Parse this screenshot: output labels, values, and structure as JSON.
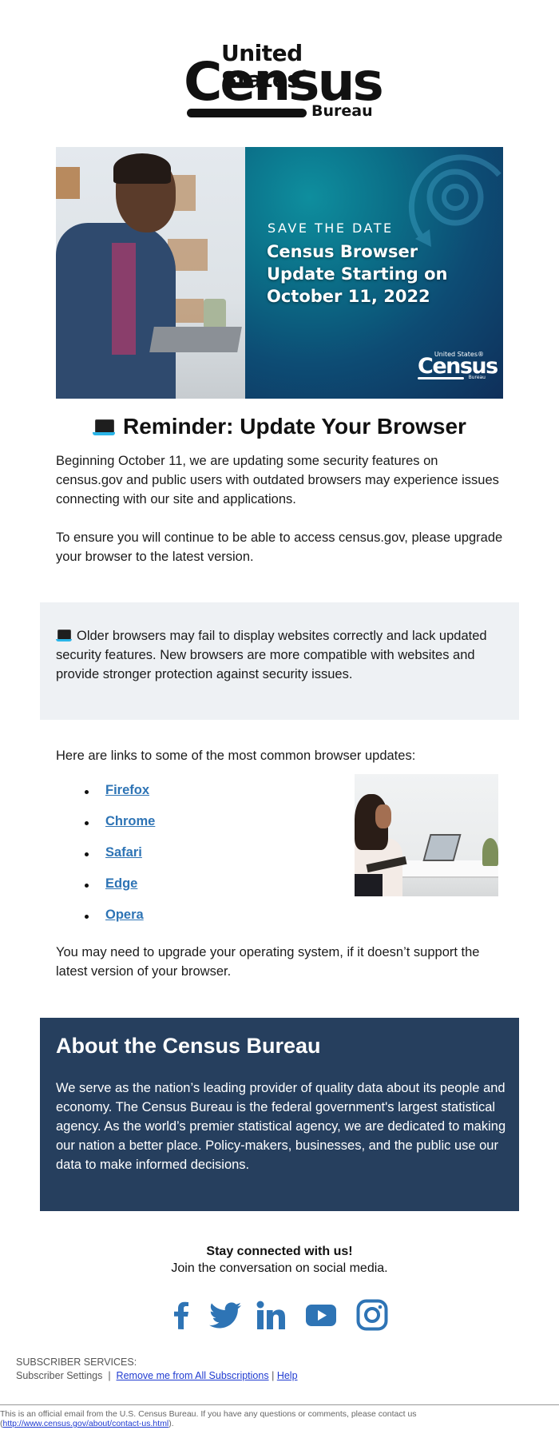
{
  "logo": {
    "line1": "United States",
    "registered": "®",
    "line2": "Census",
    "line3": "Bureau"
  },
  "hero": {
    "eyebrow": "SAVE THE DATE",
    "title": "Census Browser Update Starting on October 11, 2022",
    "mini_logo": {
      "line1": "United States®",
      "line2": "Census",
      "line3": "Bureau"
    }
  },
  "reminder": {
    "icon": "laptop-icon",
    "heading": "Reminder: Update Your Browser",
    "paragraph1": "Beginning October 11, we are updating some security features on census.gov and public users with outdated browsers may experience issues connecting with our site and applications.",
    "paragraph2": "To ensure you will continue to be able to access census.gov, please upgrade your browser to the latest version."
  },
  "notice": {
    "icon": "laptop-icon",
    "text": "Older browsers may fail to display websites correctly and lack updated security features. New browsers are more compatible with websites and provide stronger protection against security issues."
  },
  "browser_links": {
    "intro": "Here are links to some of the most common browser updates:",
    "items": [
      {
        "label": "Firefox"
      },
      {
        "label": "Chrome"
      },
      {
        "label": "Safari"
      },
      {
        "label": "Edge"
      },
      {
        "label": "Opera"
      }
    ],
    "os_note": "You may need to upgrade your operating system, if it doesn’t support the latest version of your browser."
  },
  "about": {
    "heading": "About the Census Bureau",
    "body": "We serve as the nation’s leading provider of quality data about its people and economy. The Census Bureau is the federal government's largest statistical agency. As the world’s premier statistical agency, we are dedicated to making our nation a better place. Policy-makers, businesses, and the public use our data to make informed decisions."
  },
  "social": {
    "headline": "Stay connected with us!",
    "subline": "Join the conversation on social media.",
    "icons": [
      "facebook-icon",
      "twitter-icon",
      "linkedin-icon",
      "youtube-icon",
      "instagram-icon"
    ],
    "color": "#2e74b5"
  },
  "footer": {
    "subscriber_label": "SUBSCRIBER SERVICES:",
    "settings": "Subscriber Settings",
    "sep": "|",
    "remove": "Remove me from All Subscriptions",
    "help": "Help",
    "official_text": "This is an official email from the U.S. Census Bureau. If you have any questions or comments, please contact us",
    "contact_url": "http://www.census.gov/about/contact-us.html"
  },
  "colors": {
    "notice_bg": "#eef1f4",
    "about_bg": "#263f5e",
    "link": "#2e74b5"
  }
}
